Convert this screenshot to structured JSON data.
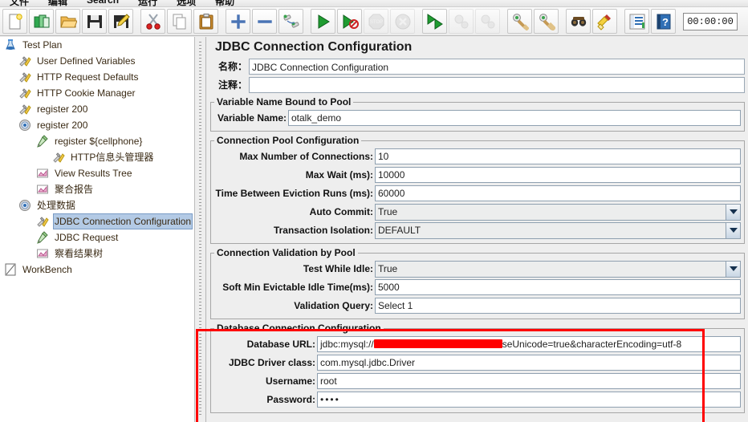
{
  "window": {
    "menu": [
      {
        "label": "文件"
      },
      {
        "label": "编辑"
      },
      {
        "label": "Search"
      },
      {
        "label": "运行"
      },
      {
        "label": "选项"
      },
      {
        "label": "帮助"
      }
    ]
  },
  "toolbar": {
    "buttons": [
      {
        "name": "new-icon",
        "title": "新建"
      },
      {
        "name": "templates-icon",
        "title": "模板"
      },
      {
        "name": "open-icon",
        "title": "打开"
      },
      {
        "name": "save-icon",
        "title": "保存"
      },
      {
        "name": "save-as-icon",
        "title": "另存为"
      },
      {
        "name": "cut-icon",
        "title": "剪切"
      },
      {
        "name": "copy-icon",
        "title": "复制"
      },
      {
        "name": "paste-icon",
        "title": "粘贴"
      },
      {
        "name": "expand-all-icon",
        "title": "展开全部"
      },
      {
        "name": "collapse-all-icon",
        "title": "折叠全部"
      },
      {
        "name": "toggle-icon",
        "title": "启用/禁用"
      },
      {
        "name": "start-icon",
        "title": "启动"
      },
      {
        "name": "start-no-pause-icon",
        "title": "无间隔启动"
      },
      {
        "name": "stop-icon",
        "title": "停止"
      },
      {
        "name": "shutdown-icon",
        "title": "关闭"
      },
      {
        "name": "start-remote-all-icon",
        "title": "远程启动所有"
      },
      {
        "name": "stop-remote-all-icon",
        "title": "远程停止所有"
      },
      {
        "name": "shutdown-remote-all-icon",
        "title": "远程关闭所有"
      },
      {
        "name": "clear-icon",
        "title": "清除"
      },
      {
        "name": "clear-all-icon",
        "title": "清除全部"
      },
      {
        "name": "search-icon",
        "title": "查找"
      },
      {
        "name": "reset-search-icon",
        "title": "重置查找"
      },
      {
        "name": "function-helper-icon",
        "title": "函数助手对话框"
      },
      {
        "name": "help-icon",
        "title": "帮助"
      }
    ],
    "timer": "00:00:00"
  },
  "tree": {
    "nodes": [
      {
        "label": "Test Plan",
        "icon": "test-plan-icon",
        "indent": 0,
        "selected": false,
        "expander": "open"
      },
      {
        "label": "User Defined Variables",
        "icon": "config-element-icon",
        "indent": 1,
        "selected": false,
        "expander": "none"
      },
      {
        "label": "HTTP Request Defaults",
        "icon": "config-element-icon",
        "indent": 1,
        "selected": false,
        "expander": "none"
      },
      {
        "label": "HTTP Cookie Manager",
        "icon": "config-element-icon",
        "indent": 1,
        "selected": false,
        "expander": "none"
      },
      {
        "label": "register 200",
        "icon": "config-element-icon",
        "indent": 1,
        "selected": false,
        "expander": "none"
      },
      {
        "label": "register 200",
        "icon": "thread-group-icon",
        "indent": 1,
        "selected": false,
        "expander": "open"
      },
      {
        "label": "register ${cellphone}",
        "icon": "sampler-icon",
        "indent": 2,
        "selected": false,
        "expander": "open"
      },
      {
        "label": "HTTP信息头管理器",
        "icon": "config-element-icon",
        "indent": 3,
        "selected": false,
        "expander": "none"
      },
      {
        "label": "View Results Tree",
        "icon": "listener-icon",
        "indent": 2,
        "selected": false,
        "expander": "none"
      },
      {
        "label": "聚合报告",
        "icon": "listener-icon",
        "indent": 2,
        "selected": false,
        "expander": "none"
      },
      {
        "label": "处理数据",
        "icon": "thread-group-icon",
        "indent": 1,
        "selected": false,
        "expander": "open"
      },
      {
        "label": "JDBC Connection Configuration",
        "icon": "config-element-icon",
        "indent": 2,
        "selected": true,
        "expander": "none"
      },
      {
        "label": "JDBC Request",
        "icon": "sampler-icon",
        "indent": 2,
        "selected": false,
        "expander": "none"
      },
      {
        "label": "察看结果树",
        "icon": "listener-icon",
        "indent": 2,
        "selected": false,
        "expander": "none"
      },
      {
        "label": "WorkBench",
        "icon": "workbench-icon",
        "indent": 0,
        "selected": false,
        "expander": "none"
      }
    ]
  },
  "main": {
    "title": "JDBC Connection Configuration",
    "name_label": "名称：",
    "name_value": "JDBC Connection Configuration",
    "comment_label": "注释：",
    "comment_value": "",
    "groups": [
      {
        "legend": "Variable Name Bound to Pool",
        "label_width": 92,
        "rows": [
          {
            "label": "Variable Name:",
            "value": "otalk_demo",
            "type": "text"
          }
        ]
      },
      {
        "legend": "Connection Pool Configuration",
        "label_width": 200,
        "rows": [
          {
            "label": "Max Number of Connections:",
            "value": "10",
            "type": "text"
          },
          {
            "label": "Max Wait (ms):",
            "value": "10000",
            "type": "text"
          },
          {
            "label": "Time Between Eviction Runs (ms):",
            "value": "60000",
            "type": "text"
          },
          {
            "label": "Auto Commit:",
            "value": "True",
            "type": "combo"
          },
          {
            "label": "Transaction Isolation:",
            "value": "DEFAULT",
            "type": "combo"
          }
        ]
      },
      {
        "legend": "Connection Validation by Pool",
        "label_width": 200,
        "rows": [
          {
            "label": "Test While Idle:",
            "value": "True",
            "type": "combo"
          },
          {
            "label": "Soft Min Evictable Idle Time(ms):",
            "value": "5000",
            "type": "text"
          },
          {
            "label": "Validation Query:",
            "value": "Select 1",
            "type": "text"
          }
        ]
      },
      {
        "legend": "Database Connection Configuration",
        "label_width": 128,
        "rows": [
          {
            "label": "Database URL:",
            "value": "jdbc:mysql://",
            "value_suffix": "seUnicode=true&characterEncoding=utf-8",
            "type": "redacted-text"
          },
          {
            "label": "JDBC Driver class:",
            "value": "com.mysql.jdbc.Driver",
            "type": "text"
          },
          {
            "label": "Username:",
            "value": "root",
            "type": "text"
          },
          {
            "label": "Password:",
            "value": "••••",
            "type": "password"
          }
        ]
      }
    ]
  },
  "annotation": {
    "highlight_color": "#ff0000",
    "target_group": "Database Connection Configuration"
  }
}
